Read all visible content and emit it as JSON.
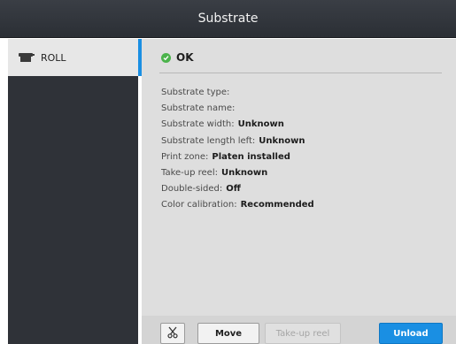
{
  "header": {
    "title": "Substrate"
  },
  "sidebar": {
    "items": [
      {
        "label": "ROLL",
        "icon": "roll-icon",
        "selected": true
      }
    ]
  },
  "main": {
    "status": {
      "label": "OK",
      "icon": "check-icon",
      "color": "#4bb34b"
    },
    "properties": [
      {
        "label": "Substrate type:",
        "value": ""
      },
      {
        "label": "Substrate name:",
        "value": ""
      },
      {
        "label": "Substrate width:",
        "value": "Unknown"
      },
      {
        "label": "Substrate length left:",
        "value": "Unknown"
      },
      {
        "label": "Print zone:",
        "value": "Platen installed"
      },
      {
        "label": "Take-up reel:",
        "value": "Unknown"
      },
      {
        "label": "Double-sided:",
        "value": "Off"
      },
      {
        "label": "Color calibration:",
        "value": "Recommended"
      }
    ]
  },
  "toolbar": {
    "cut_icon": "scissors-icon",
    "move_label": "Move",
    "takeup_label": "Take-up reel",
    "takeup_enabled": false,
    "unload_label": "Unload"
  },
  "colors": {
    "accent": "#1a8fe3",
    "header": "#2b2f35",
    "sidebar": "#2f3238",
    "panel": "#dedede"
  }
}
